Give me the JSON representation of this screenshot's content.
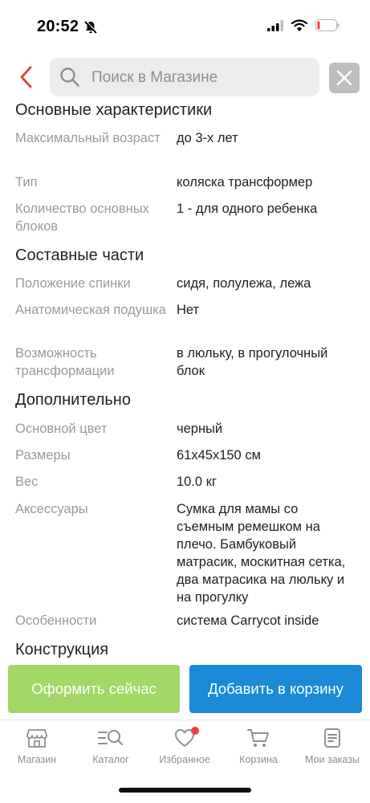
{
  "status_bar": {
    "time": "20:52"
  },
  "search": {
    "placeholder": "Поиск в Магазине"
  },
  "sections": {
    "main": {
      "title": "Основные характеристики",
      "rows": [
        {
          "label": "Максимальный возраст",
          "value": "до 3-х лет"
        },
        {
          "label": "Тип",
          "value": "коляска трансформер"
        },
        {
          "label": "Количество основных блоков",
          "value": "1 - для одного ребенка"
        }
      ]
    },
    "parts": {
      "title": "Составные части",
      "rows": [
        {
          "label": "Положение спинки",
          "value": "сидя, полулежа, лежа"
        },
        {
          "label": "Анатомическая подушка",
          "value": "Нет"
        },
        {
          "label": "Возможность трансформации",
          "value": "в люльку, в прогулочный блок"
        }
      ]
    },
    "extra": {
      "title": "Дополнительно",
      "rows": [
        {
          "label": "Основной цвет",
          "value": "черный"
        },
        {
          "label": "Размеры",
          "value": "61х45х150 см"
        },
        {
          "label": "Вес",
          "value": "10.0 кг"
        },
        {
          "label": "Аксессуары",
          "value": "Сумка для мамы со съемным ремешком на плечо. Бамбуковый матрасик, москитная сетка, два матрасика на люльку и на прогулку"
        },
        {
          "label": "Особенности",
          "value": "система Carrycot inside"
        }
      ]
    },
    "construction": {
      "title": "Конструкция"
    }
  },
  "buttons": {
    "checkout": "Оформить сейчас",
    "add_to_cart": "Добавить в корзину"
  },
  "tabs": [
    {
      "label": "Магазин",
      "icon": "store-icon"
    },
    {
      "label": "Каталог",
      "icon": "catalog-search-icon"
    },
    {
      "label": "Избранное",
      "icon": "heart-icon"
    },
    {
      "label": "Корзина",
      "icon": "cart-icon"
    },
    {
      "label": "Мои заказы",
      "icon": "orders-icon"
    }
  ],
  "colors": {
    "accent_red": "#e8443a",
    "checkout_green": "#a3d766",
    "cart_blue": "#1a8ad6",
    "label_gray": "#9a9a9a"
  }
}
